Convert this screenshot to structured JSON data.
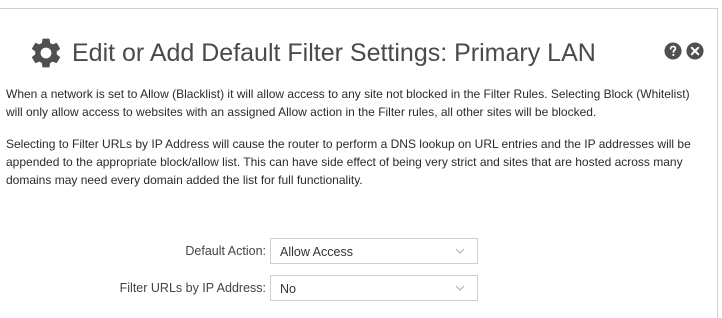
{
  "dialog": {
    "title": "Edit or Add Default Filter Settings: Primary LAN",
    "icons": {
      "title": "gear-icon",
      "help": "help-icon",
      "close": "close-icon"
    },
    "colors": {
      "icon": "#505050",
      "title": "#4a4a4a"
    }
  },
  "description": {
    "p1": "When a network is set to Allow (Blacklist) it will allow access to any site not blocked in the Filter Rules. Selecting Block (Whitelist) will only allow access to websites with an assigned Allow action in the Filter rules, all other sites will be blocked.",
    "p2": "Selecting to Filter URLs by IP Address will cause the router to perform a DNS lookup on URL entries and the IP addresses will be appended to the appropriate block/allow list. This can have side effect of being very strict and sites that are hosted across many domains may need every domain added the list for full functionality."
  },
  "form": {
    "default_action": {
      "label": "Default Action:",
      "value": "Allow Access"
    },
    "filter_by_ip": {
      "label": "Filter URLs by IP Address:",
      "value": "No"
    }
  }
}
